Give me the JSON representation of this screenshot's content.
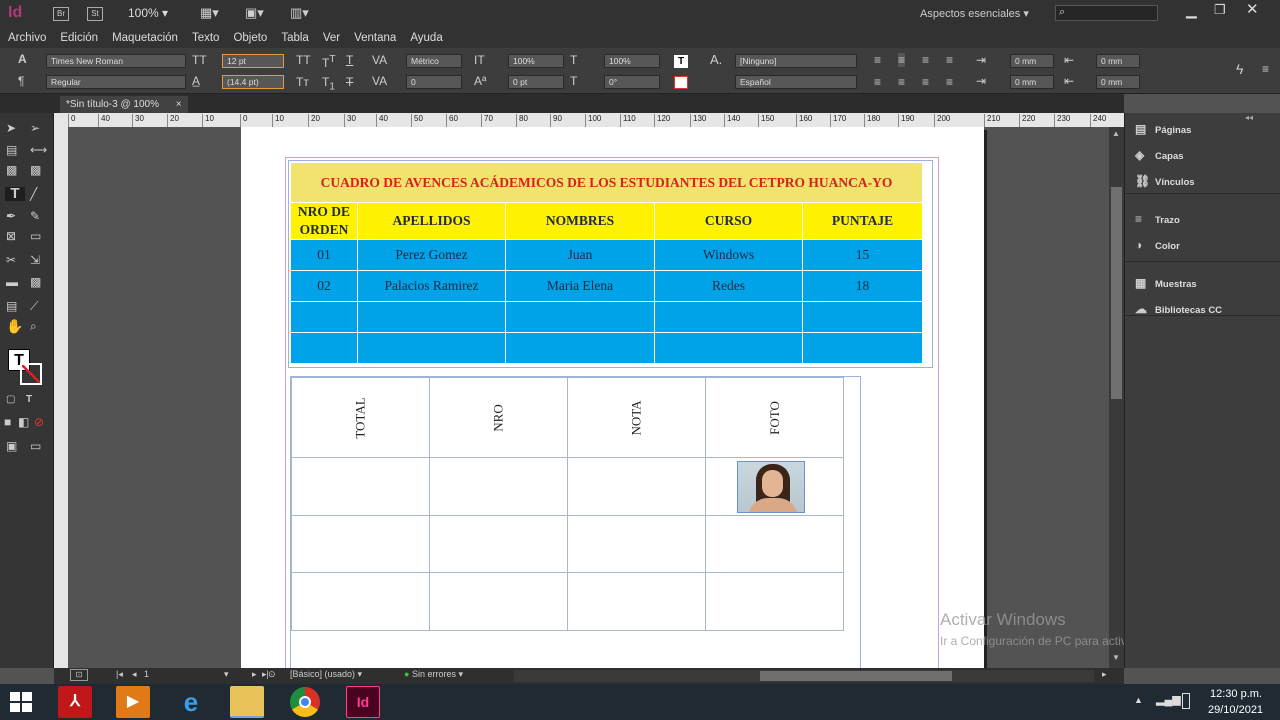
{
  "app": {
    "logo": "Id",
    "bridge": "Br",
    "stock": "St",
    "zoom": "100%",
    "workspace": "Aspectos esenciales",
    "search_placeholder": ""
  },
  "menu": [
    "Archivo",
    "Edición",
    "Maquetación",
    "Texto",
    "Objeto",
    "Tabla",
    "Ver",
    "Ventana",
    "Ayuda"
  ],
  "control": {
    "font_family": "Times New Roman",
    "font_style": "Regular",
    "font_size": "12 pt",
    "leading": "(14.4 pt)",
    "kerning": "Métrico",
    "tracking": "0",
    "vscale": "100%",
    "baseline": "0 pt",
    "hscale": "100%",
    "skew": "0°",
    "char_style": "[Ninguno]",
    "language": "Español",
    "indent1": "0 mm",
    "indent2": "0 mm",
    "indent3": "0 mm",
    "indent4": "0 mm"
  },
  "doc_tab": {
    "title": "*Sin título-3 @ 100%",
    "close": "×"
  },
  "ruler_labels": [
    "0",
    "40",
    "30",
    "20",
    "10",
    "0",
    "10",
    "20",
    "30",
    "40",
    "50",
    "60",
    "70",
    "80",
    "90",
    "100",
    "110",
    "120",
    "130",
    "140",
    "150",
    "160",
    "170",
    "180",
    "190",
    "200",
    "210",
    "220",
    "230",
    "240"
  ],
  "table1": {
    "title": "CUADRO DE AVENCES ACÁDEMICOS DE LOS ESTUDIANTES DEL CETPRO HUANCA-YO",
    "headers": [
      "NRO DE ORDEN",
      "APELLIDOS",
      "NOMBRES",
      "CURSO",
      "PUNTAJE"
    ],
    "rows": [
      [
        "01",
        "Perez Gomez",
        "Juan",
        "Windows",
        "15"
      ],
      [
        "02",
        "Palacios Ramirez",
        "Maria Elena",
        "Redes",
        "18"
      ],
      [
        "",
        "",
        "",
        "",
        ""
      ],
      [
        "",
        "",
        "",
        "",
        ""
      ]
    ],
    "colors": {
      "title_bg": "#f0e36e",
      "title_text": "#d8201f",
      "header_bg": "#fff200",
      "row_bg": "#00a2e8"
    }
  },
  "table2": {
    "headers": [
      "TOTAL",
      "NRO",
      "NOTA",
      "FOTO"
    ],
    "photo": "photo-of-smiling-woman"
  },
  "right_panel": [
    {
      "label": "Páginas",
      "icon": "pages-icon"
    },
    {
      "label": "Capas",
      "icon": "layers-icon"
    },
    {
      "label": "Vínculos",
      "icon": "links-icon"
    },
    {
      "label": "Trazo",
      "icon": "stroke-icon"
    },
    {
      "label": "Color",
      "icon": "color-icon"
    },
    {
      "label": "Muestras",
      "icon": "swatches-icon"
    },
    {
      "label": "Bibliotecas CC",
      "icon": "cc-libraries-icon"
    }
  ],
  "status": {
    "page": "1",
    "preset": "[Básico] (usado)",
    "errors": "Sin errores"
  },
  "watermark": {
    "title": "Activar Windows",
    "subtitle": "Ir a Configuración de PC para activar Windows."
  },
  "taskbar": {
    "time": "12:30 p.m.",
    "date": "29/10/2021"
  }
}
